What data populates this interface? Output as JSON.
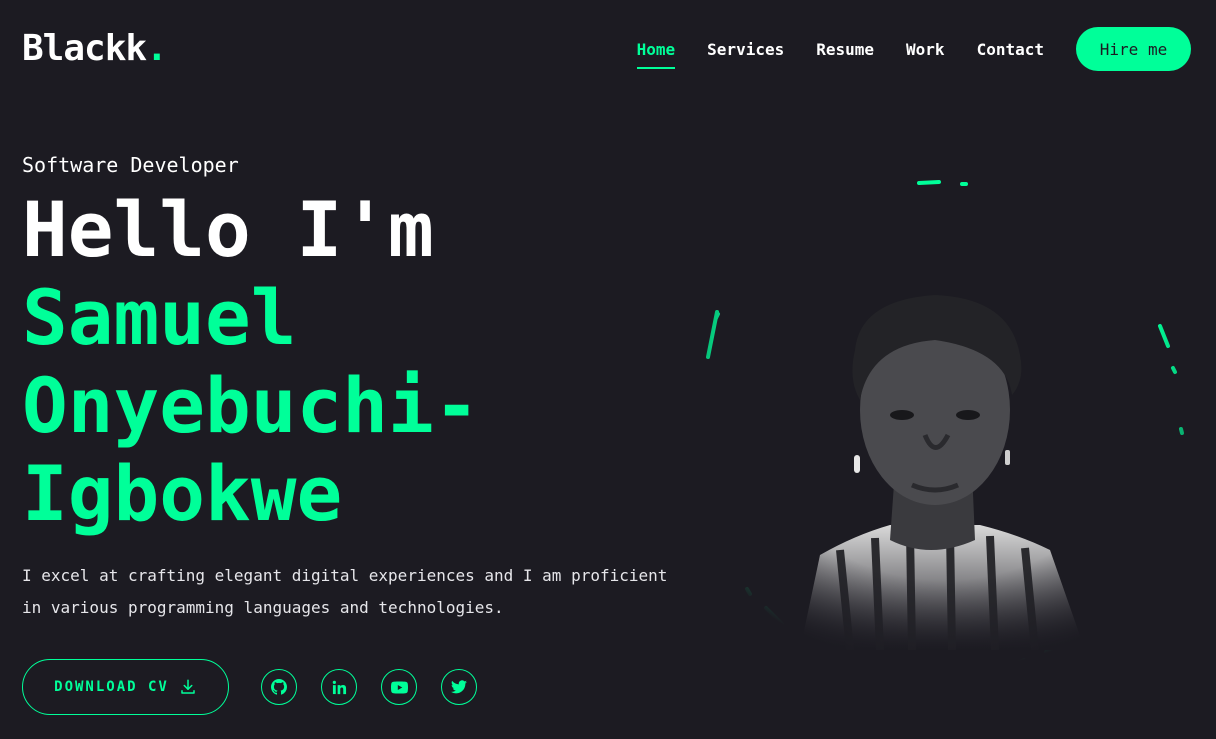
{
  "brand": {
    "name": "Blackk",
    "dot": "."
  },
  "nav": {
    "items": [
      {
        "label": "Home",
        "active": true
      },
      {
        "label": "Services",
        "active": false
      },
      {
        "label": "Resume",
        "active": false
      },
      {
        "label": "Work",
        "active": false
      },
      {
        "label": "Contact",
        "active": false
      }
    ],
    "cta": "Hire me"
  },
  "hero": {
    "subtitle": "Software Developer",
    "greeting": "Hello I'm",
    "name_line1": "Samuel",
    "name_line2": "Onyebuchi-",
    "name_line3": "Igbokwe",
    "intro_line1": "I excel at crafting elegant digital experiences and I am proficient",
    "intro_line2": "in various programming languages and technologies.",
    "download_label": "DOWNLOAD CV"
  },
  "socials": [
    {
      "icon": "github-icon"
    },
    {
      "icon": "linkedin-icon"
    },
    {
      "icon": "youtube-icon"
    },
    {
      "icon": "twitter-icon"
    }
  ],
  "colors": {
    "accent": "#00ff99",
    "background": "#1c1b22",
    "text": "#ffffff"
  }
}
